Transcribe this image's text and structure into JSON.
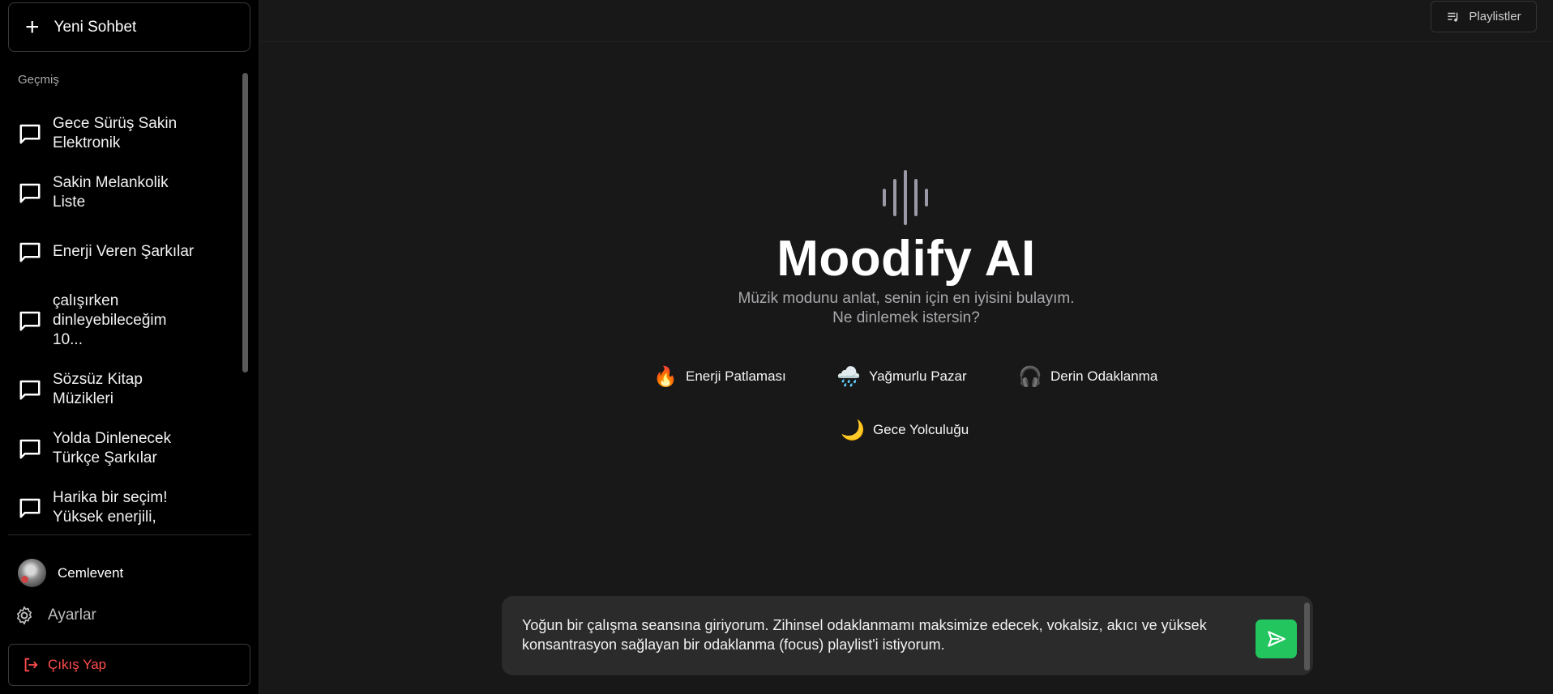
{
  "sidebar": {
    "new_chat_label": "Yeni Sohbet",
    "history_title": "Geçmiş",
    "history": [
      {
        "label": "Gece Sürüş Sakin Elektronik"
      },
      {
        "label": "Sakin Melankolik Liste"
      },
      {
        "label": "Enerji Veren Şarkılar"
      },
      {
        "label": "çalışırken dinleyebileceğim 10..."
      },
      {
        "label": "Sözsüz Kitap Müzikleri"
      },
      {
        "label": "Yolda Dinlenecek Türkçe Şarkılar"
      },
      {
        "label": "Harika bir seçim! Yüksek enerjili,"
      }
    ],
    "user_name": "Cemlevent",
    "settings_label": "Ayarlar",
    "logout_label": "Çıkış Yap"
  },
  "topbar": {
    "playlists_label": "Playlistler"
  },
  "hero": {
    "title": "Moodify AI",
    "subtitle_line1": "Müzik modunu anlat, senin için en iyisini bulayım.",
    "subtitle_line2": "Ne dinlemek istersin?"
  },
  "suggestions": [
    {
      "emoji": "🔥",
      "icon": "fire-icon",
      "label": "Enerji Patlaması"
    },
    {
      "emoji": "🌧️",
      "icon": "rain-cloud-icon",
      "label": "Yağmurlu Pazar"
    },
    {
      "emoji": "🎧",
      "icon": "headphones-icon",
      "label": "Derin Odaklanma"
    },
    {
      "emoji": "🌙",
      "icon": "moon-icon",
      "label": "Gece Yolculuğu"
    }
  ],
  "composer": {
    "value": "Yoğun bir çalışma seansına giriyorum. Zihinsel odaklanmamı maksimize edecek, vokalsiz, akıcı ve yüksek konsantrasyon sağlayan bir odaklanma (focus) playlist'i istiyorum."
  },
  "colors": {
    "background": "#181818",
    "sidebar": "#000000",
    "accent_send": "#22c55e",
    "logout_text": "#ff4d4d"
  }
}
